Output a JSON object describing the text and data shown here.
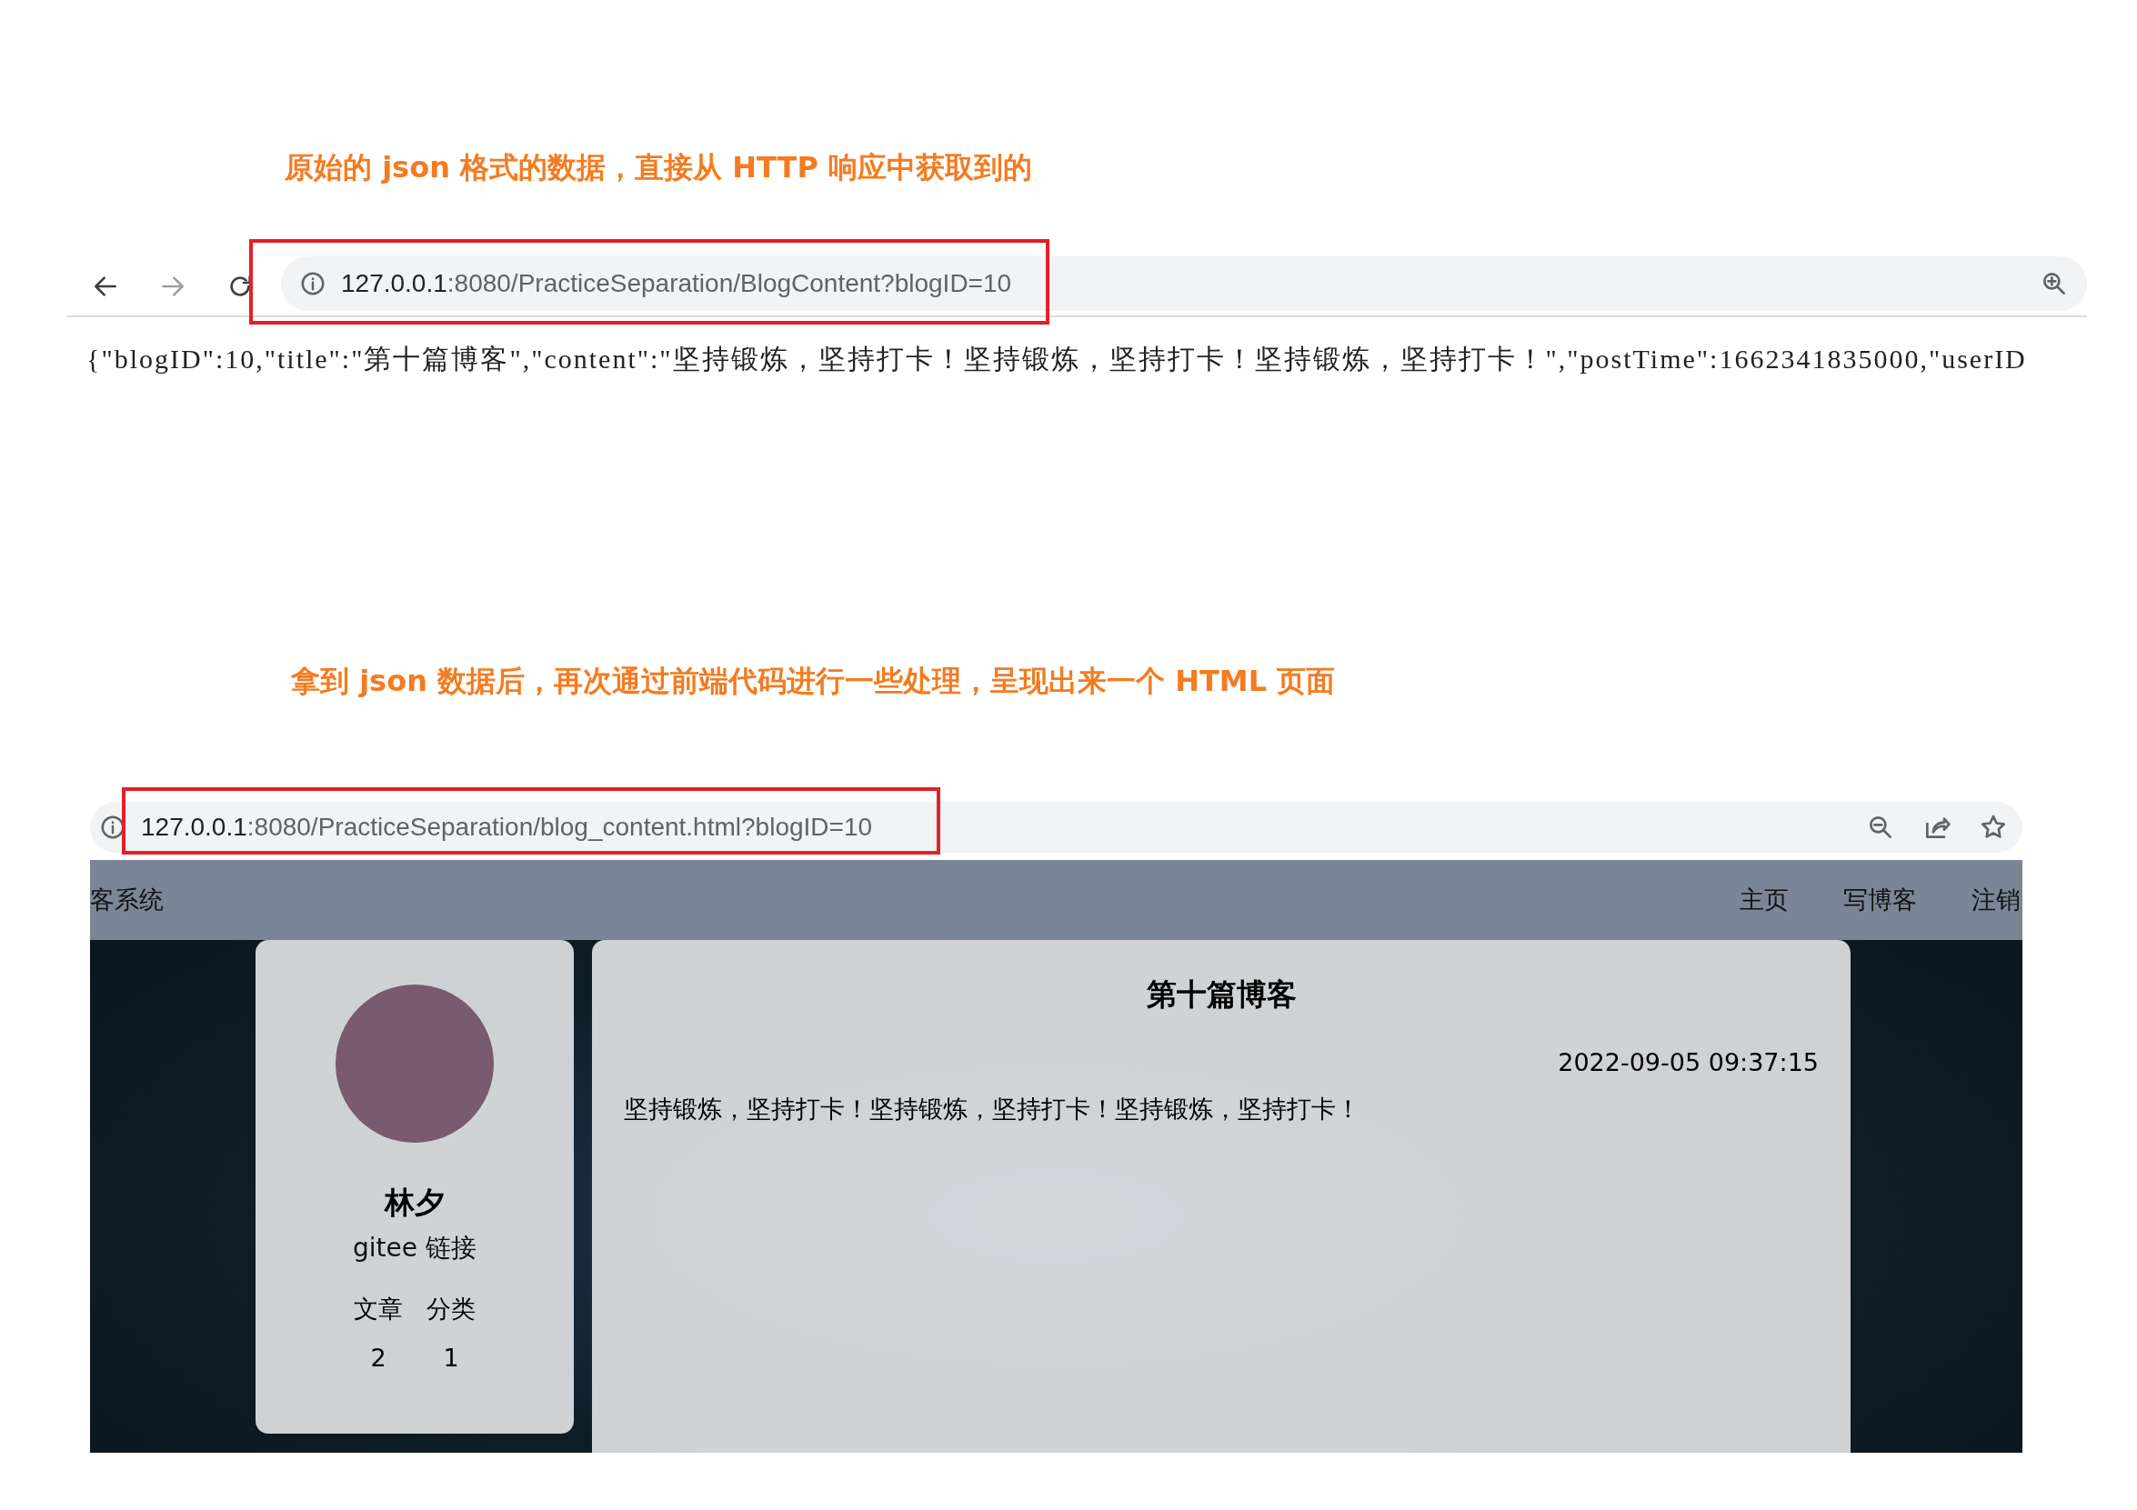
{
  "top_section": {
    "caption": "原始的 json 格式的数据，直接从 HTTP 响应中获取到的",
    "address_bar": {
      "host": "127.0.0.1",
      "rest": ":8080/PracticeSeparation/BlogContent?blogID=10"
    },
    "response_text": "{\"blogID\":10,\"title\":\"第十篇博客\",\"content\":\"坚持锻炼，坚持打卡！坚持锻炼，坚持打卡！坚持锻炼，坚持打卡！\",\"postTime\":1662341835000,\"userID"
  },
  "bottom_section": {
    "caption": "拿到 json 数据后，再次通过前端代码进行一些处理，呈现出来一个 HTML 页面",
    "address_bar": {
      "host": "127.0.0.1",
      "rest": ":8080/PracticeSeparation/blog_content.html?blogID=10"
    },
    "blog_page": {
      "site_title": "客系统",
      "nav": [
        "主页",
        "写博客",
        "注销"
      ],
      "profile": {
        "name": "林夕",
        "link": "gitee 链接",
        "stats": [
          {
            "label": "文章",
            "value": "2"
          },
          {
            "label": "分类",
            "value": "1"
          }
        ]
      },
      "article": {
        "title": "第十篇博客",
        "date": "2022-09-05 09:37:15",
        "content": "坚持锻炼，坚持打卡！坚持锻炼，坚持打卡！坚持锻炼，坚持打卡！"
      }
    }
  }
}
